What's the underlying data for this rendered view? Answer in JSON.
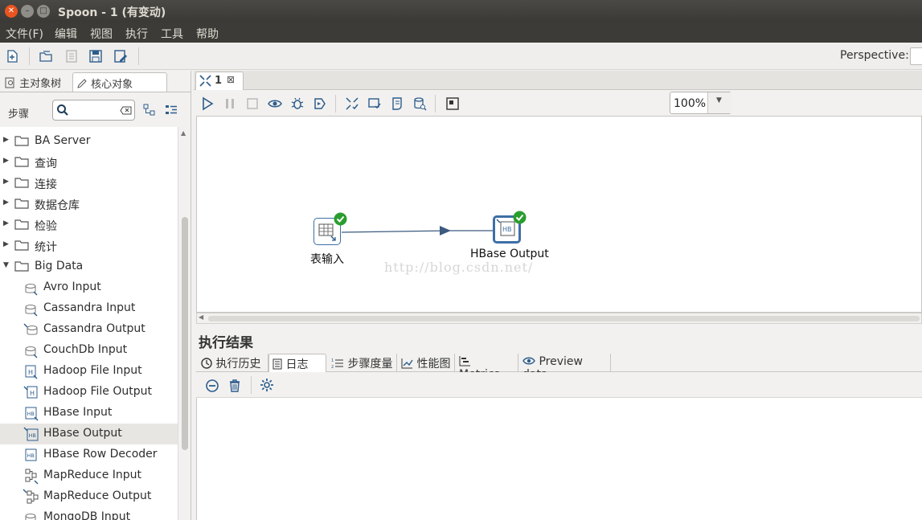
{
  "window": {
    "title": "Spoon - 1 (有变动)"
  },
  "menu": [
    "文件(F)",
    "编辑",
    "视图",
    "执行",
    "工具",
    "帮助"
  ],
  "toolbar": {
    "perspective_label": "Perspective:"
  },
  "left_panel": {
    "tabs": [
      "主对象树",
      "核心对象"
    ],
    "steps_label": "步骤",
    "search_placeholder": "",
    "tree": [
      {
        "label": "BA Server",
        "type": "folder"
      },
      {
        "label": "查询",
        "type": "folder"
      },
      {
        "label": "连接",
        "type": "folder"
      },
      {
        "label": "数据仓库",
        "type": "folder"
      },
      {
        "label": "检验",
        "type": "folder"
      },
      {
        "label": "统计",
        "type": "folder"
      },
      {
        "label": "Big Data",
        "type": "folder-open"
      },
      {
        "label": "Avro Input",
        "type": "step"
      },
      {
        "label": "Cassandra Input",
        "type": "step"
      },
      {
        "label": "Cassandra Output",
        "type": "step"
      },
      {
        "label": "CouchDb Input",
        "type": "step"
      },
      {
        "label": "Hadoop File Input",
        "type": "step"
      },
      {
        "label": "Hadoop File Output",
        "type": "step"
      },
      {
        "label": "HBase Input",
        "type": "step"
      },
      {
        "label": "HBase Output",
        "type": "step",
        "selected": true
      },
      {
        "label": "HBase Row Decoder",
        "type": "step"
      },
      {
        "label": "MapReduce Input",
        "type": "step"
      },
      {
        "label": "MapReduce Output",
        "type": "step"
      },
      {
        "label": "MongoDB Input",
        "type": "step"
      }
    ]
  },
  "canvas_tab": {
    "label": "1"
  },
  "zoom": {
    "value": "100%"
  },
  "canvas": {
    "nodes": [
      {
        "label": "表输入",
        "icon_text": ""
      },
      {
        "label": "HBase Output",
        "icon_text": "HB"
      }
    ],
    "watermark": "http://blog.csdn.net/"
  },
  "results": {
    "title": "执行结果",
    "tabs": [
      "执行历史",
      "日志",
      "步骤度量",
      "性能图",
      "Metrics",
      "Preview data"
    ],
    "active_tab": "日志"
  },
  "colors": {
    "titlebar": "#3c3b37",
    "check_green": "#2a9d2f",
    "hop_arrow": "#3d5a80"
  }
}
